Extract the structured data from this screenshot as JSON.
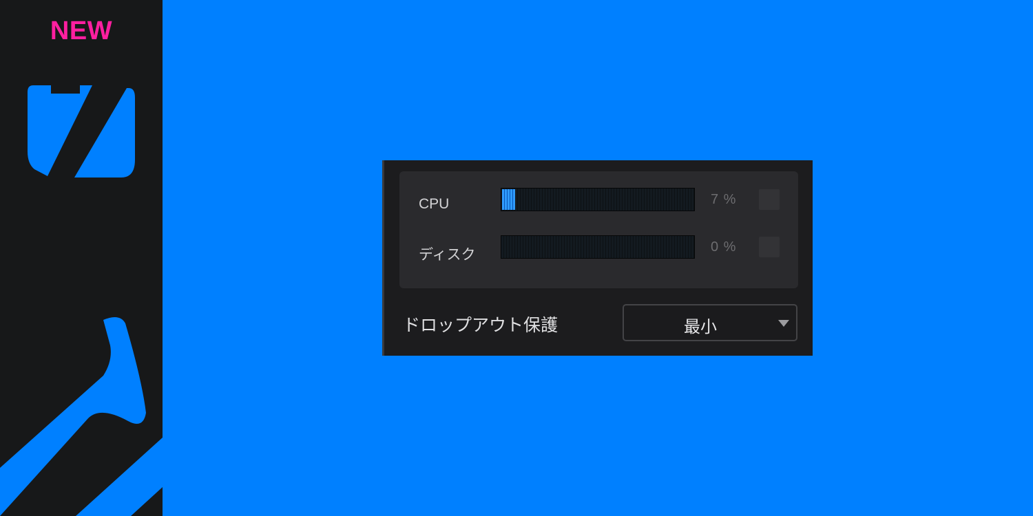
{
  "sidebar": {
    "badge": "NEW",
    "badge_color": "#ff1fa0",
    "logo_icon": "z-logo-icon",
    "accent_color": "#0080ff"
  },
  "panel": {
    "meters": [
      {
        "label": "CPU",
        "value_text": "7 %",
        "level": 0.07
      },
      {
        "label": "ディスク",
        "value_text": "0 %",
        "level": 0.0
      }
    ],
    "dropout": {
      "label": "ドロップアウト保護",
      "selected": "最小"
    }
  }
}
